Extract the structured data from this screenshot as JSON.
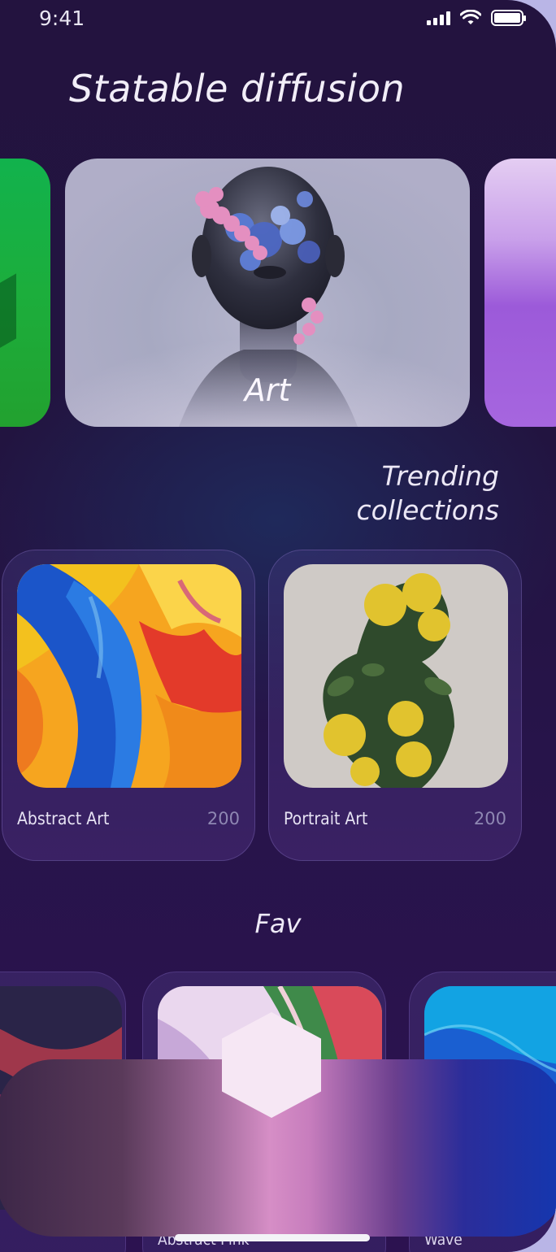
{
  "status": {
    "time": "9:41"
  },
  "app": {
    "title": "Statable diffusion"
  },
  "hero": {
    "label": "Art"
  },
  "trending": {
    "title_line1": "Trending",
    "title_line2": "collections",
    "cards": [
      {
        "label": "Abstract Art",
        "count": "200"
      },
      {
        "label": "Portrait Art",
        "count": "200"
      }
    ]
  },
  "fav": {
    "title": "Fav",
    "cards": [
      {
        "label": ""
      },
      {
        "label": "Abstract Pink"
      },
      {
        "label": "Wave"
      }
    ]
  },
  "icons": [
    "signal-icon",
    "wifi-icon",
    "battery-icon",
    "create-hexagon-icon"
  ]
}
